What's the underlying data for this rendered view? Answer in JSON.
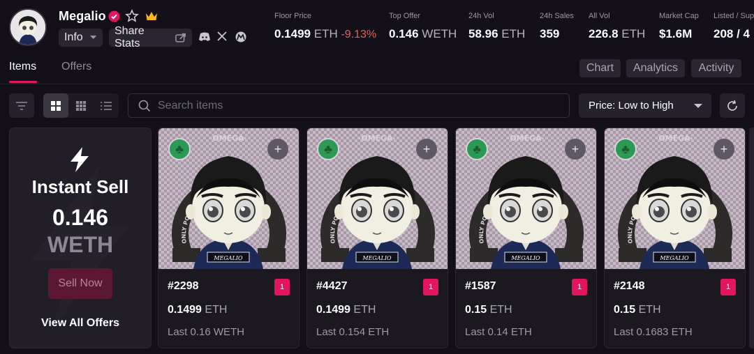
{
  "collection": {
    "name": "Megalio",
    "info_label": "Info",
    "share_label": "Share Stats"
  },
  "stats": [
    {
      "label": "Floor Price",
      "value": "0.1499",
      "unit": "ETH",
      "change": "-9.13%"
    },
    {
      "label": "Top Offer",
      "value": "0.146",
      "unit": "WETH"
    },
    {
      "label": "24h Vol",
      "value": "58.96",
      "unit": "ETH"
    },
    {
      "label": "24h Sales",
      "value": "359"
    },
    {
      "label": "All Vol",
      "value": "226.8",
      "unit": "ETH"
    },
    {
      "label": "Market Cap",
      "value": "$1.6M"
    },
    {
      "label": "Listed / Sup",
      "value": "208 / 4"
    }
  ],
  "tabs": [
    {
      "label": "Items",
      "active": true
    },
    {
      "label": "Offers",
      "active": false
    }
  ],
  "view_pills": [
    "Chart",
    "Analytics",
    "Activity"
  ],
  "search": {
    "placeholder": "Search items"
  },
  "sort": {
    "selected": "Price: Low to High"
  },
  "instant_sell": {
    "title": "Instant Sell",
    "price": "0.146",
    "unit": "WETH",
    "button": "Sell Now",
    "view_all": "View All Offers"
  },
  "items": [
    {
      "id": "#2298",
      "badge": "1",
      "price": "0.1499",
      "unit": "ETH",
      "last": "Last 0.16 WETH"
    },
    {
      "id": "#4427",
      "badge": "1",
      "price": "0.1499",
      "unit": "ETH",
      "last": "Last 0.154 ETH"
    },
    {
      "id": "#1587",
      "badge": "1",
      "price": "0.15",
      "unit": "ETH",
      "last": "Last 0.14 ETH"
    },
    {
      "id": "#2148",
      "badge": "1",
      "price": "0.15",
      "unit": "ETH",
      "last": "Last 0.1683 ETH"
    }
  ],
  "artwork_text": {
    "ring": "ONLY POSSIBLE ON MEGAETH",
    "top": "OMEGA",
    "shirt": "MEGALIO"
  },
  "colors": {
    "accent": "#e2155e",
    "background": "#131019",
    "negative": "#ef5a5a",
    "clover": "#2c9a55"
  }
}
